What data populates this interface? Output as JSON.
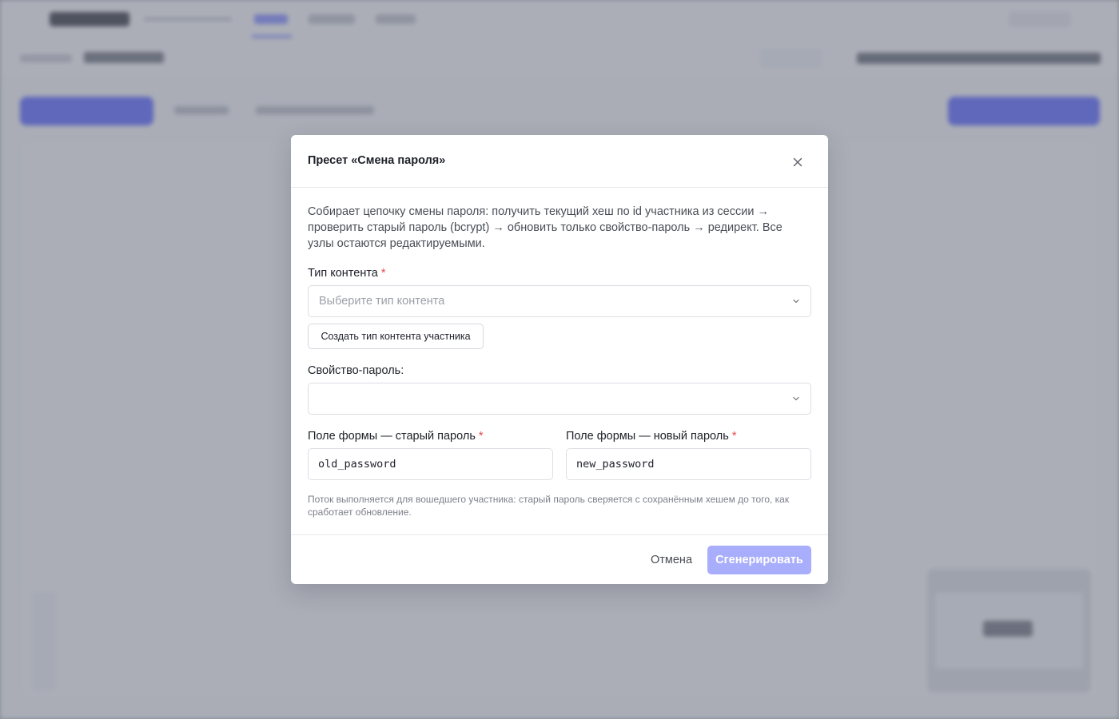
{
  "modal": {
    "title": "Пресет «Смена пароля»",
    "description": "Собирает цепочку смены пароля: получить текущий хеш по id участника из сессии → проверить старый пароль (bcrypt) → обновить только свойство-пароль → редирект. Все узлы остаются редактируемыми.",
    "content_type": {
      "label": "Тип контента",
      "required_mark": "*",
      "placeholder": "Выберите тип контента",
      "create_button": "Создать тип контента участника"
    },
    "password_property": {
      "label": "Свойство-пароль:",
      "value": ""
    },
    "old_password_field": {
      "label": "Поле формы — старый пароль",
      "required_mark": "*",
      "value": "old_password"
    },
    "new_password_field": {
      "label": "Поле формы — новый пароль",
      "required_mark": "*",
      "value": "new_password"
    },
    "hint": "Поток выполняется для вошедшего участника: старый пароль сверяется с сохранённым хешем до того, как сработает обновление.",
    "footer": {
      "cancel_label": "Отмена",
      "generate_label": "Сгенерировать",
      "generate_disabled": true
    }
  },
  "colors": {
    "accent": "#4f5bff",
    "accent_disabled": "#a9aefc",
    "required": "#e5484d",
    "overlay": "#6e7382"
  },
  "icons": {
    "close": "close-icon",
    "chevron": "chevron-down-icon"
  }
}
